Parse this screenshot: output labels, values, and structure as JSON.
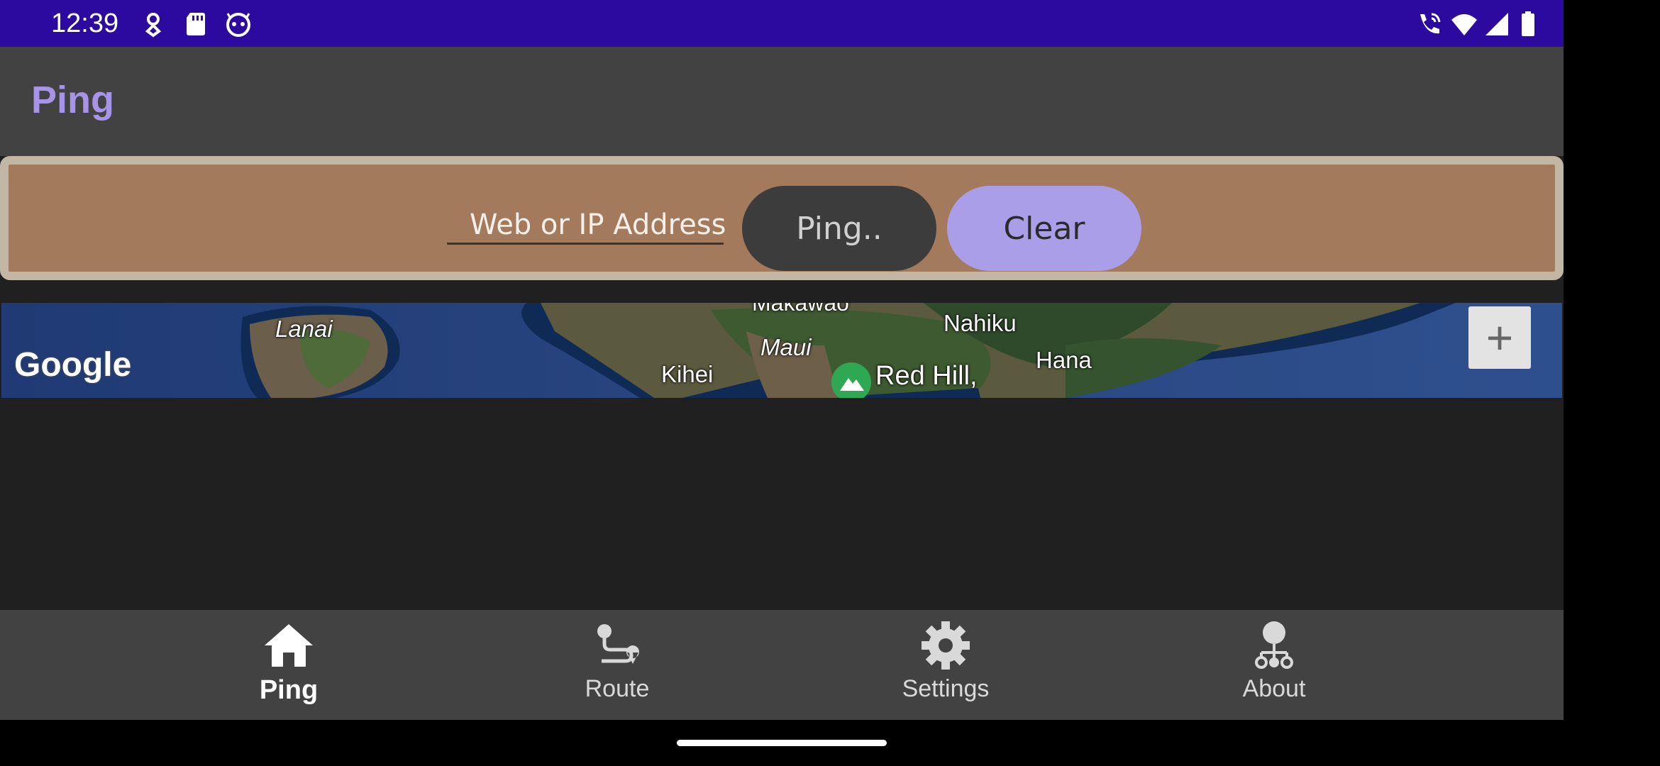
{
  "status_bar": {
    "time": "12:39"
  },
  "toolbar": {
    "title": "Ping"
  },
  "form": {
    "address_placeholder": "Web or IP Address",
    "ping_label": "Ping..",
    "clear_label": "Clear"
  },
  "map": {
    "labels": {
      "makawao": "Makawao",
      "lanai": "Lanai",
      "maui": "Maui",
      "nahiku": "Nahiku",
      "kihei": "Kihei",
      "red_hill": "Red Hill,",
      "hana": "Hana"
    },
    "google": "Google",
    "zoom_in": "+"
  },
  "nav": {
    "ping": "Ping",
    "route": "Route",
    "settings": "Settings",
    "about": "About"
  },
  "colors": {
    "status_bar": "#2d0a9f",
    "accent": "#a794e8",
    "card": "#a37a5c"
  }
}
